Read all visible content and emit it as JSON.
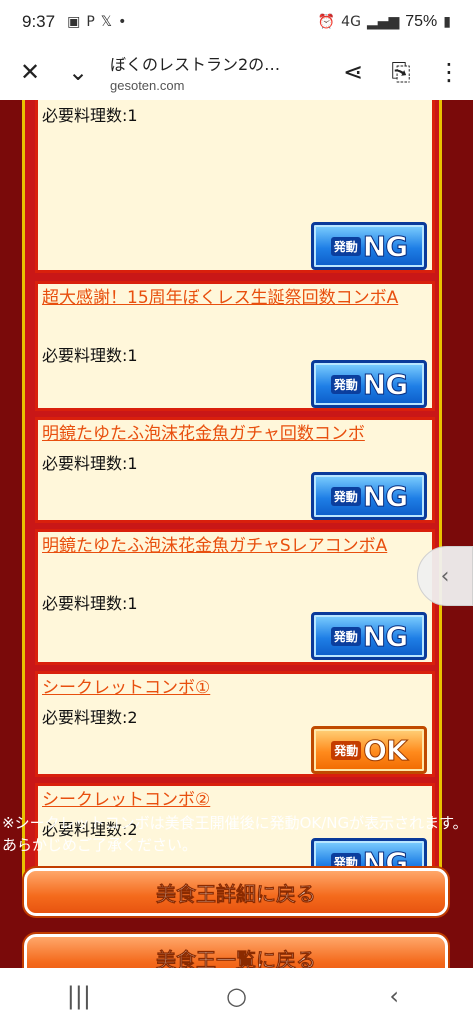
{
  "status_bar": {
    "time": "9:37",
    "battery": "75%",
    "network": "4G"
  },
  "toolbar": {
    "title": "ぼくのレストラン2の…",
    "domain": "gesoten.com"
  },
  "combos": [
    {
      "name": "",
      "req_label": "必要料理数:",
      "req_value": "1",
      "status": "NG"
    },
    {
      "name": "超大感謝！15周年ぼくレス生誕祭回数コンボA",
      "req_label": "必要料理数:",
      "req_value": "1",
      "status": "NG"
    },
    {
      "name": "明鏡たゆたふ泡沫花金魚ガチャ回数コンボ",
      "req_label": "必要料理数:",
      "req_value": "1",
      "status": "NG"
    },
    {
      "name": "明鏡たゆたふ泡沫花金魚ガチャSレアコンボA",
      "req_label": "必要料理数:",
      "req_value": "1",
      "status": "NG"
    },
    {
      "name": "シークレットコンボ①",
      "req_label": "必要料理数:",
      "req_value": "2",
      "status": "OK"
    },
    {
      "name": "シークレットコンボ②",
      "req_label": "必要料理数:",
      "req_value": "2",
      "status": "NG"
    }
  ],
  "badge": {
    "prefix": "発動",
    "ng": "NG",
    "ok": "OK"
  },
  "note": "※シークレットコンボは美食王開催後に発動OK/NGが表示されます。あらかじめご了承ください。",
  "buttons": {
    "back_detail": "美食王詳細に戻る",
    "back_list": "美食王一覧に戻る"
  },
  "colors": {
    "background": "#7a0a0a",
    "panel": "#c91717",
    "card": "#fff7da",
    "link": "#e84f0e",
    "ng_badge": "#1f7fe6",
    "ok_badge": "#ff8a1c",
    "button": "#f46a1c"
  }
}
